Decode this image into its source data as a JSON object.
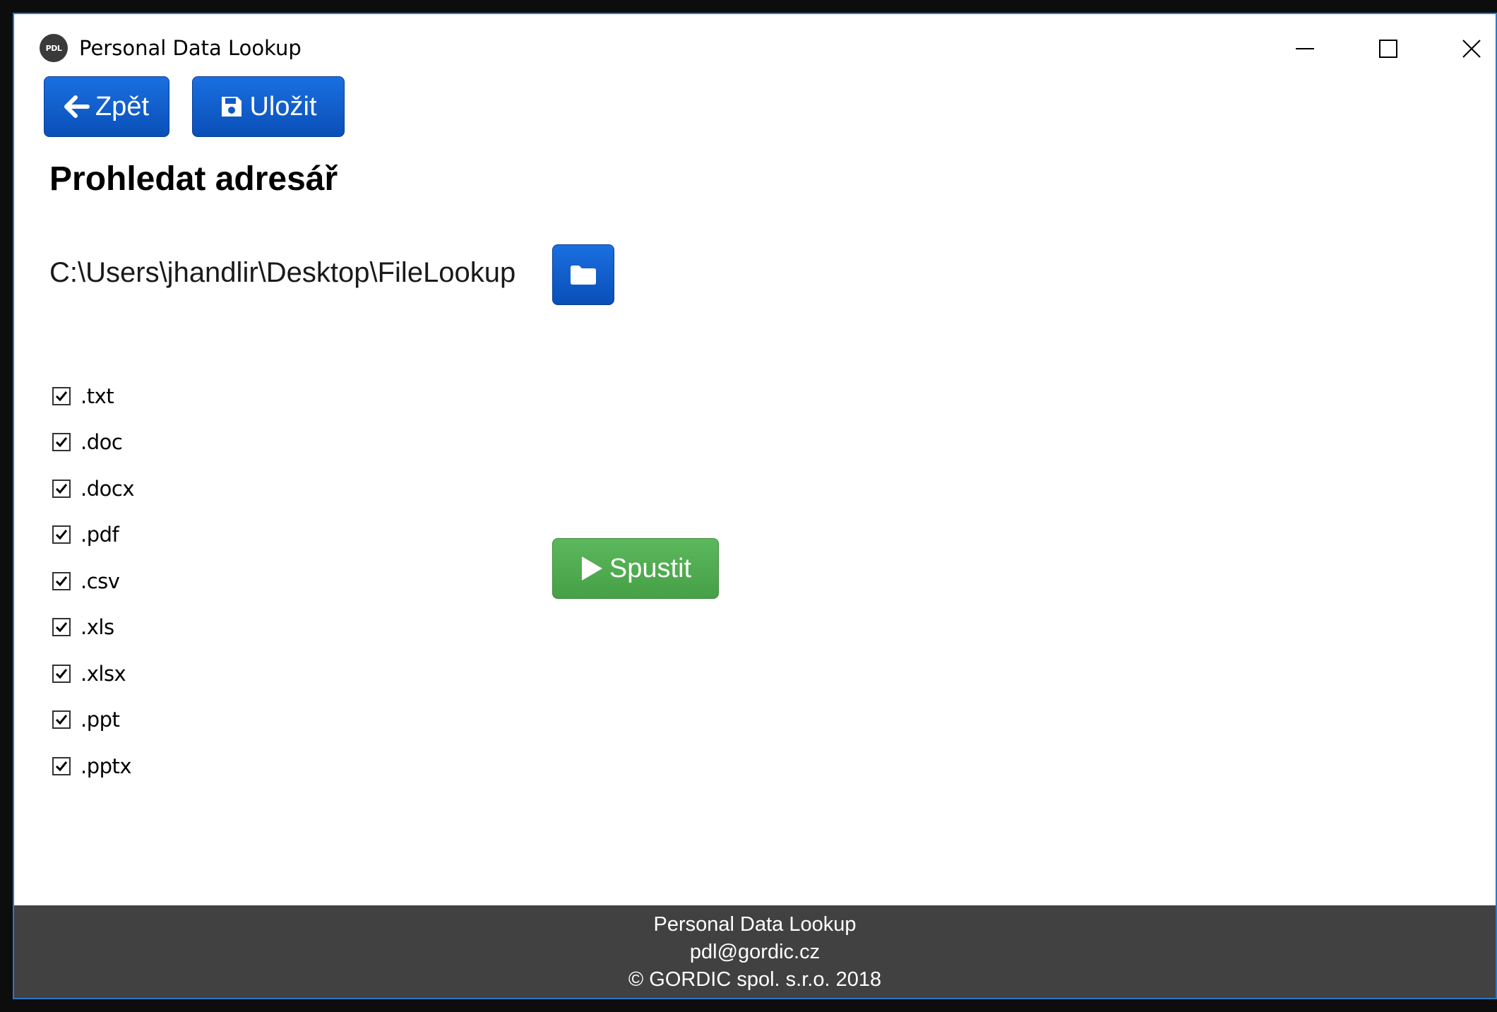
{
  "window": {
    "title": "Personal Data Lookup",
    "logo_text": "PDL"
  },
  "toolbar": {
    "back_label": "Zpět",
    "save_label": "Uložit"
  },
  "main": {
    "heading": "Prohledat adresář",
    "folder_path": "C:\\Users\\jhandlir\\Desktop\\FileLookup",
    "run_label": "Spustit",
    "extensions": [
      {
        "label": ".txt",
        "checked": true
      },
      {
        "label": ".doc",
        "checked": true
      },
      {
        "label": ".docx",
        "checked": true
      },
      {
        "label": ".pdf",
        "checked": true
      },
      {
        "label": ".csv",
        "checked": true
      },
      {
        "label": ".xls",
        "checked": true
      },
      {
        "label": ".xlsx",
        "checked": true
      },
      {
        "label": ".ppt",
        "checked": true
      },
      {
        "label": ".pptx",
        "checked": true
      }
    ]
  },
  "footer": {
    "line1": "Personal Data Lookup",
    "line2": "pdl@gordic.cz",
    "line3": "© GORDIC spol. s.r.o. 2018"
  },
  "colors": {
    "primary_button": "#0a5cd0",
    "success_button": "#4cae4c",
    "footer_bg": "#414141",
    "window_border": "#2a78c8"
  },
  "icons": {
    "back": "arrow-left-icon",
    "save": "floppy-disk-icon",
    "folder": "folder-icon",
    "run": "play-icon"
  }
}
